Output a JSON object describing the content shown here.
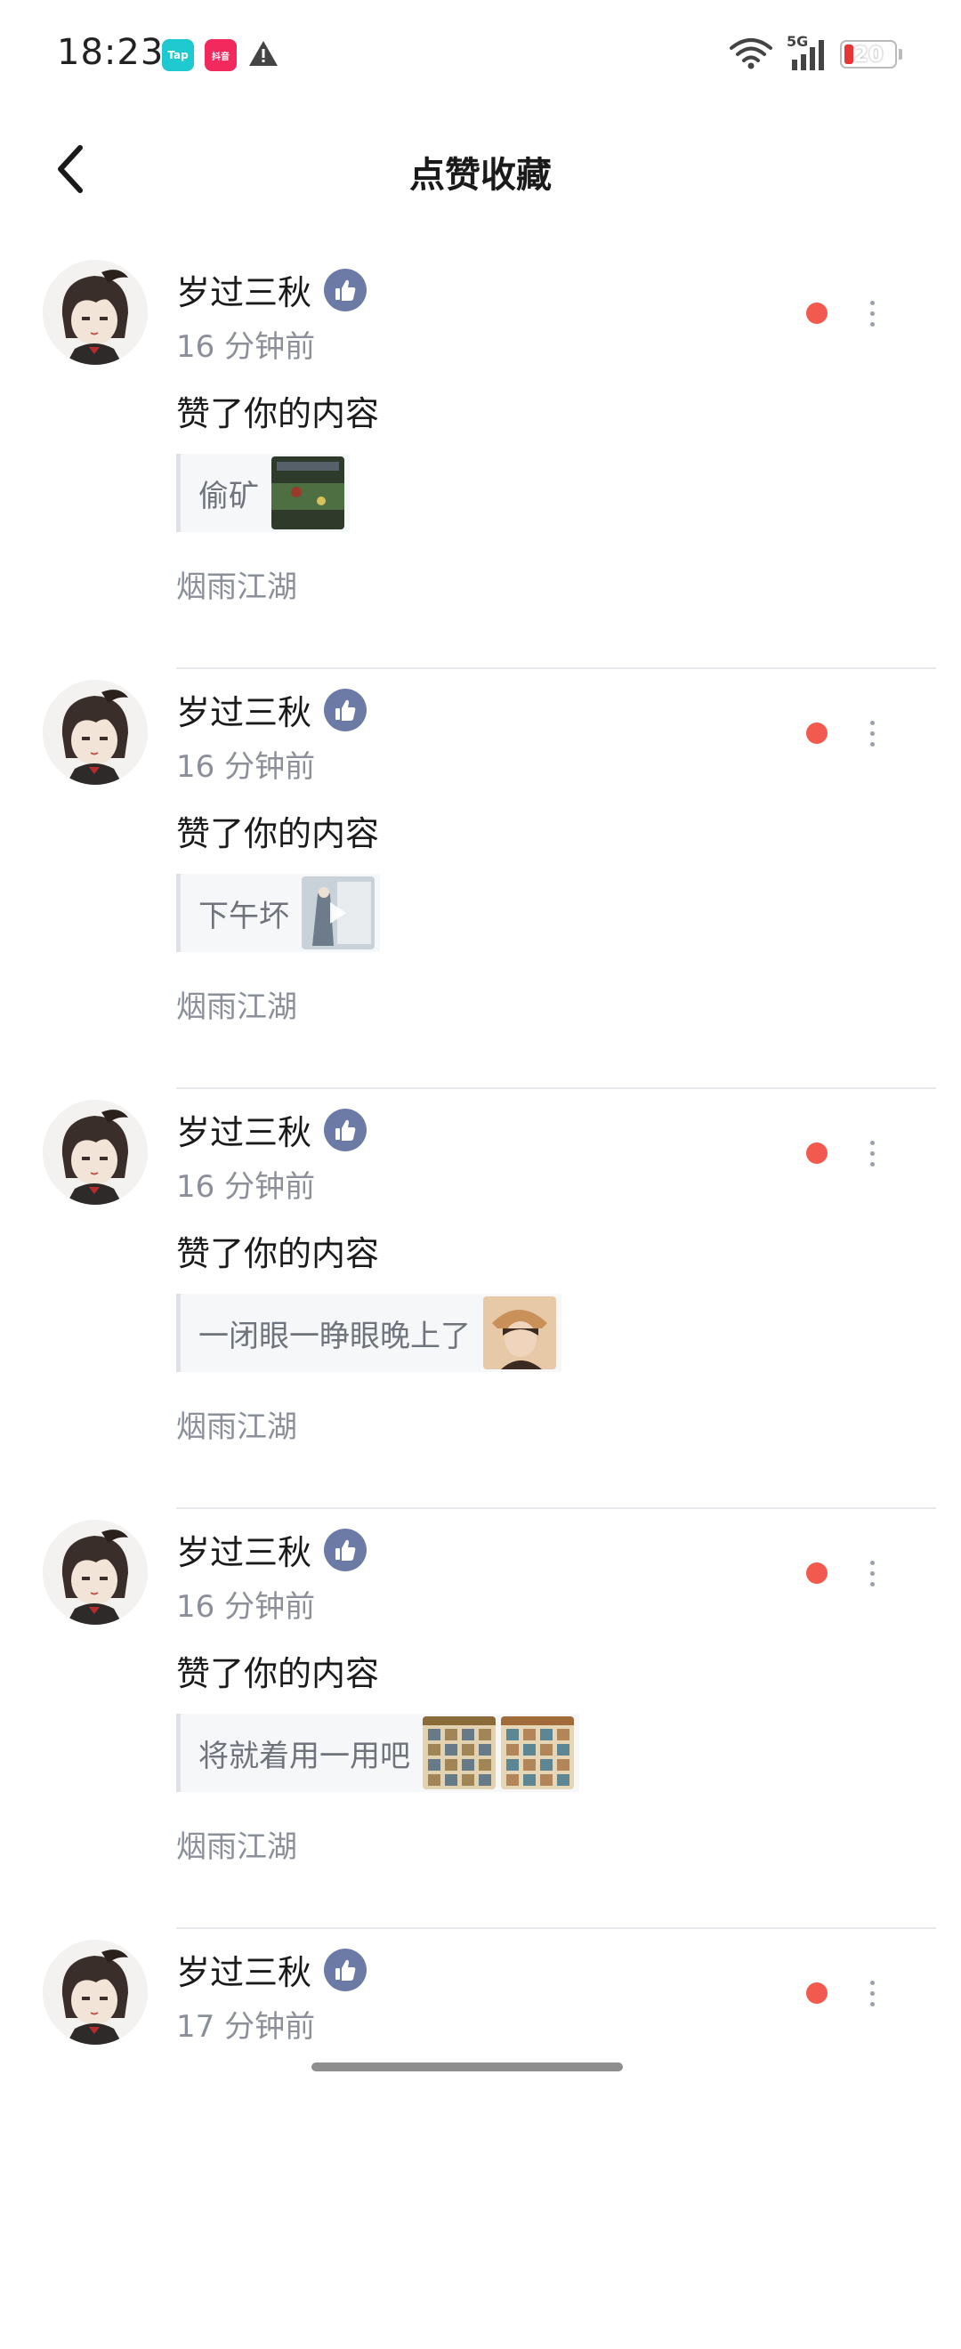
{
  "status_bar": {
    "time": "18:23",
    "apps": [
      {
        "name": "taptap-icon",
        "label": "Tap",
        "color": "#1ec9cf"
      },
      {
        "name": "douyin-icon",
        "label": "抖音",
        "color": "#f2295d"
      }
    ],
    "network": "5G",
    "battery": "20"
  },
  "header": {
    "title": "点赞收藏"
  },
  "notifications": [
    {
      "username": "岁过三秋",
      "time": "16 分钟前",
      "action": "赞了你的内容",
      "quote": "偷矿",
      "thumbs": [
        {
          "kind": "game-scene",
          "colors": [
            "#2f3b2a",
            "#4e6f42",
            "#9a3a2a"
          ],
          "play": false
        }
      ],
      "group": "烟雨江湖"
    },
    {
      "username": "岁过三秋",
      "time": "16 分钟前",
      "action": "赞了你的内容",
      "quote": "下午坏",
      "thumbs": [
        {
          "kind": "character-card",
          "colors": [
            "#c9d2d8",
            "#6d7b8a",
            "#e8ecef"
          ],
          "play": true
        }
      ],
      "group": "烟雨江湖"
    },
    {
      "username": "岁过三秋",
      "time": "16 分钟前",
      "action": "赞了你的内容",
      "quote": "一闭眼一睁眼晚上了",
      "thumbs": [
        {
          "kind": "portrait",
          "colors": [
            "#c9905a",
            "#3a2a20",
            "#e7c9a8"
          ],
          "play": false
        }
      ],
      "group": "烟雨江湖"
    },
    {
      "username": "岁过三秋",
      "time": "16 分钟前",
      "action": "赞了你的内容",
      "quote": "将就着用一用吧",
      "thumbs": [
        {
          "kind": "inventory",
          "colors": [
            "#e2d2b0",
            "#8b6b3a",
            "#3d5c7a"
          ],
          "play": false
        },
        {
          "kind": "inventory",
          "colors": [
            "#e6d6b6",
            "#a26b3a",
            "#2f6b8a"
          ],
          "play": false
        }
      ],
      "group": "烟雨江湖"
    },
    {
      "username": "岁过三秋",
      "time": "17 分钟前",
      "action": "",
      "quote": "",
      "thumbs": [],
      "group": ""
    }
  ],
  "colors": {
    "unread": "#f25a4e",
    "like_badge": "#6c7aa6",
    "secondary_text": "#8a8f99"
  }
}
